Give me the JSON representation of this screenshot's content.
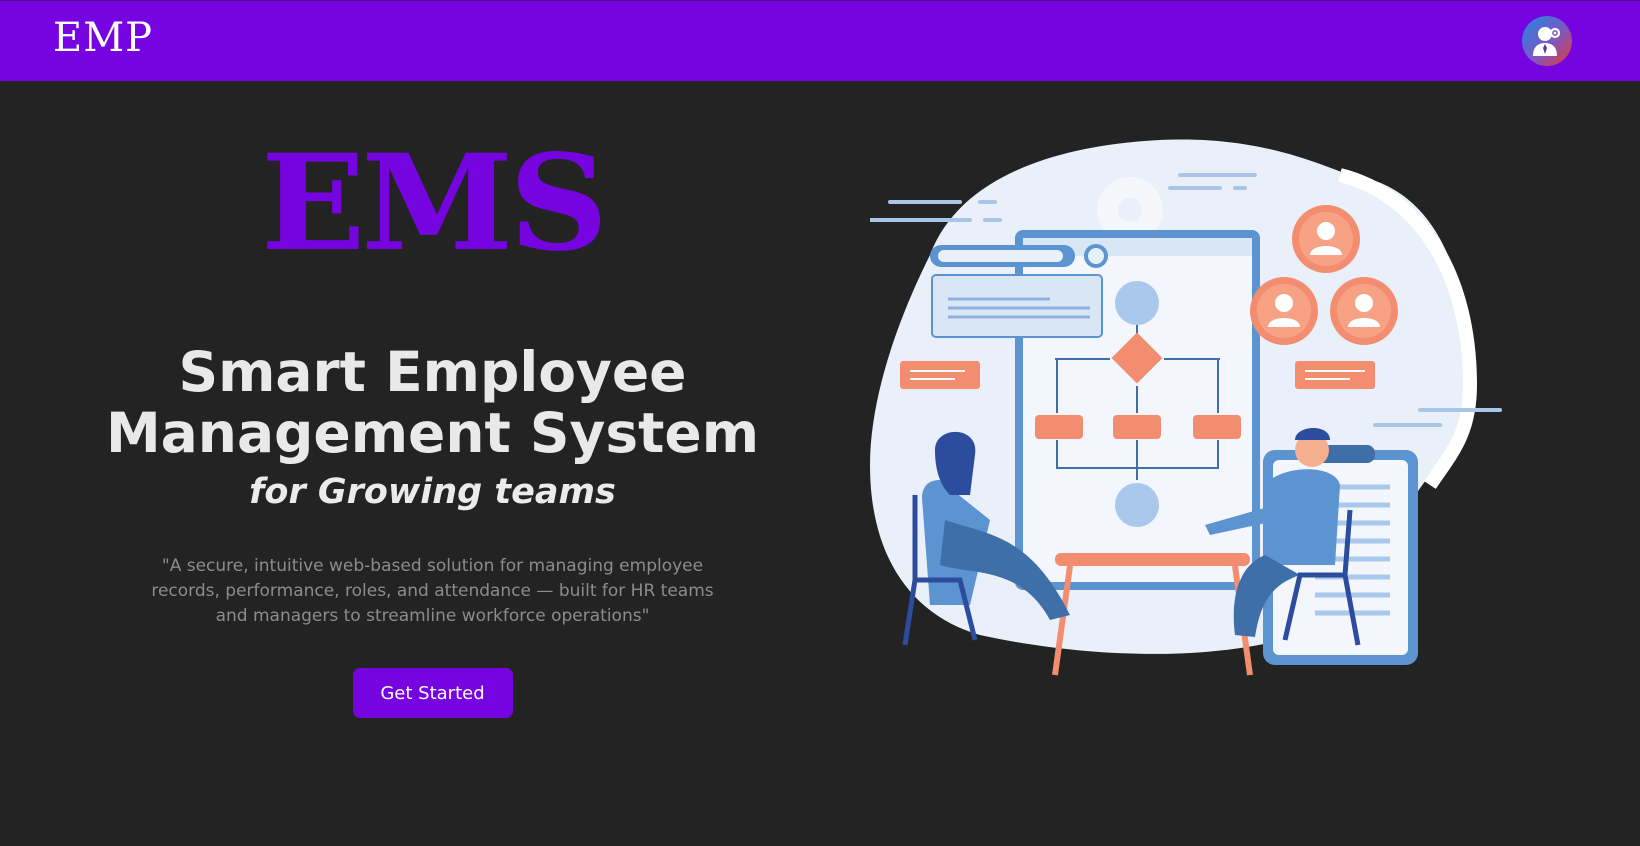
{
  "navbar": {
    "brand": "EMP",
    "avatar_icon": "user-gear-icon"
  },
  "hero": {
    "logo_text": "EMS",
    "headline_line1": "Smart Employee",
    "headline_line2": "Management System",
    "tagline": "for Growing teams",
    "description": "\"A secure, intuitive web-based solution for managing employee records, performance, roles, and attendance — built for HR teams and managers to streamline workforce operations\"",
    "cta_label": "Get Started"
  },
  "illustration": {
    "icon": "team-workflow-illustration"
  },
  "colors": {
    "accent": "#7504e1",
    "background": "#232323",
    "text": "#e9e9e9",
    "muted": "#8c8c8c"
  }
}
